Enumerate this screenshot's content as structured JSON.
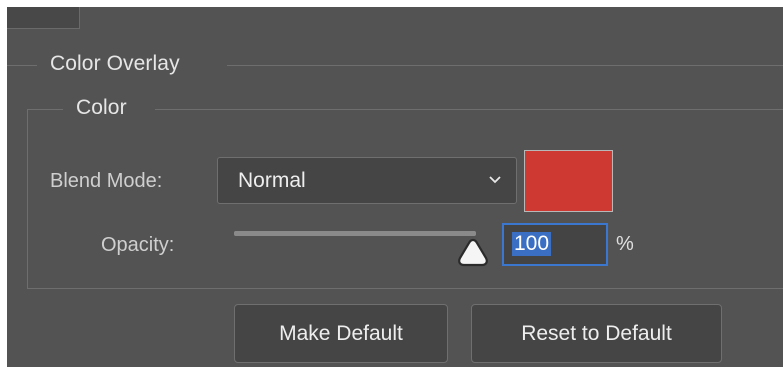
{
  "panel": {
    "section_title": "Color Overlay",
    "group_title": "Color"
  },
  "blend_mode": {
    "label": "Blend Mode:",
    "selected": "Normal",
    "icon": "chevron-down-icon"
  },
  "color_swatch": {
    "color": "#ce3a31"
  },
  "opacity": {
    "label": "Opacity:",
    "value": "100",
    "unit": "%",
    "slider_percent": 100
  },
  "buttons": {
    "make_default": "Make Default",
    "reset_default": "Reset to Default"
  },
  "colors": {
    "background": "#535353",
    "accent_focus": "#3c77cf",
    "swatch": "#ce3a31"
  }
}
